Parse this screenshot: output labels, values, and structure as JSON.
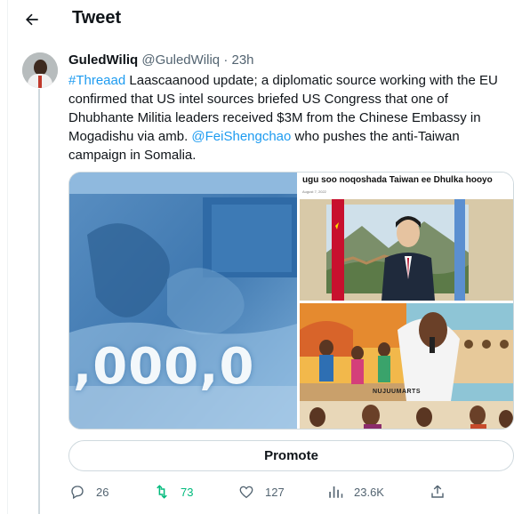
{
  "header": {
    "title": "Tweet"
  },
  "tweet": {
    "author_name": "GuledWiliq",
    "author_handle": "@GuledWiliq",
    "separator": "·",
    "time": "23h",
    "text": {
      "hashtag": "#Threaad",
      "part1": " Laascaanood update; a diplomatic source working with the EU confirmed that US intel sources briefed US Congress that one of Dhubhante Militia leaders received $3M from the Chinese Embassy in Mogadishu via amb. ",
      "mention": "@FeiShengchao",
      "part2": " who pushes the anti-Taiwan campaign in Somalia."
    },
    "media": {
      "left_image_text": ",000,0",
      "top_right_headline": "ugu soo noqoshada Taiwan ee Dhulka hooyo",
      "top_right_date": "August 7, 2022",
      "bottom_right_label": "NUJUUMARTS"
    }
  },
  "promote": {
    "label": "Promote"
  },
  "actions": {
    "replies": "26",
    "retweets": "73",
    "likes": "127",
    "views": "23.6K"
  },
  "colors": {
    "link": "#1d9bf0",
    "retweet": "#00ba7c",
    "muted": "#536471"
  }
}
